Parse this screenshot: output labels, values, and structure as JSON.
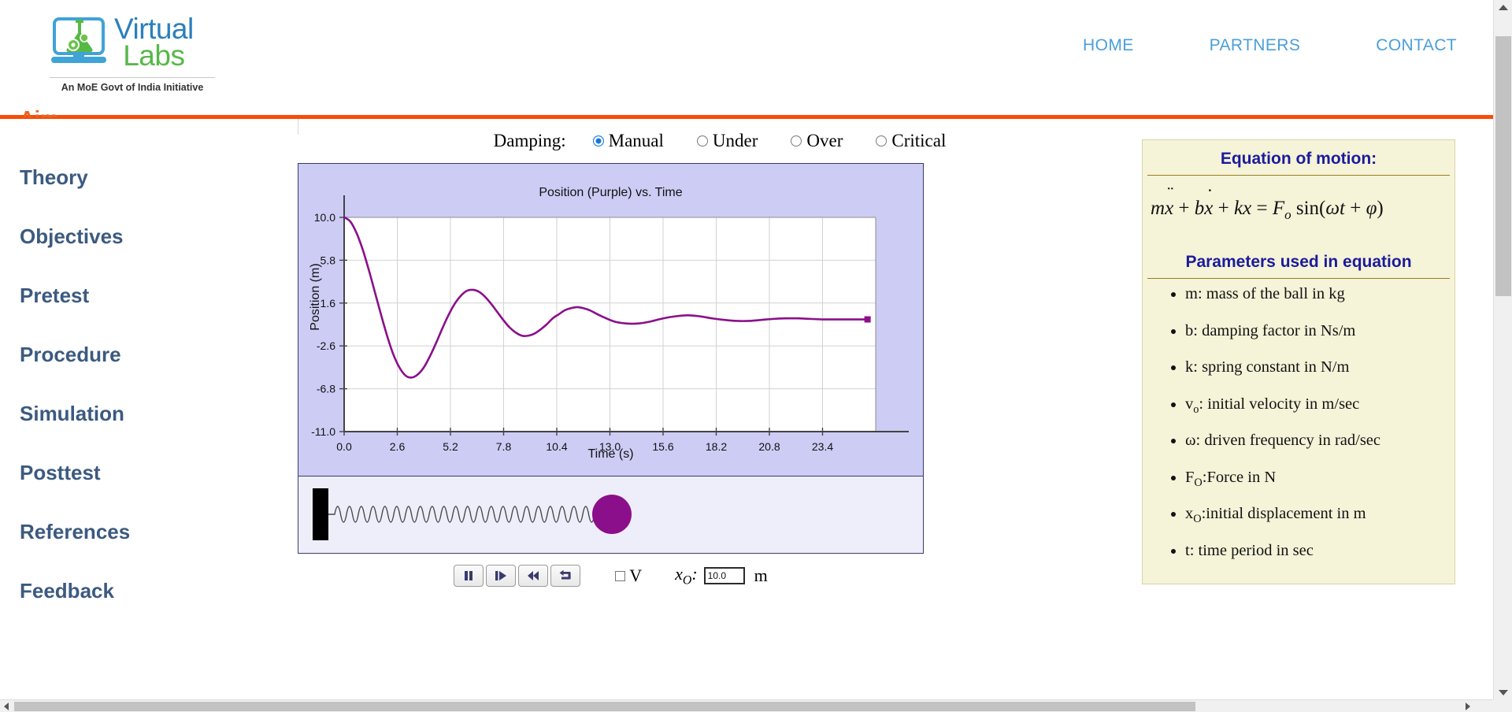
{
  "header": {
    "logo_primary": "Virtual",
    "logo_secondary": "Labs",
    "logo_tagline": "An MoE Govt of India Initiative",
    "nav": [
      {
        "label": "HOME"
      },
      {
        "label": "PARTNERS"
      },
      {
        "label": "CONTACT"
      }
    ],
    "accent_color": "#fa4b09",
    "nav_link_color": "#4a9fd8"
  },
  "sidebar": {
    "items": [
      {
        "label": "Aim",
        "active": true
      },
      {
        "label": "Theory",
        "active": false
      },
      {
        "label": "Objectives",
        "active": false
      },
      {
        "label": "Pretest",
        "active": false
      },
      {
        "label": "Procedure",
        "active": false
      },
      {
        "label": "Simulation",
        "active": false
      },
      {
        "label": "Posttest",
        "active": false
      },
      {
        "label": "References",
        "active": false
      },
      {
        "label": "Feedback",
        "active": false
      }
    ],
    "active_color": "#e8641e",
    "item_color": "#3c5a80"
  },
  "damping": {
    "label": "Damping:",
    "options": [
      {
        "label": "Manual",
        "selected": true
      },
      {
        "label": "Under",
        "selected": false
      },
      {
        "label": "Over",
        "selected": false
      },
      {
        "label": "Critical",
        "selected": false
      }
    ],
    "selected_color": "#1677e0"
  },
  "chart_data": {
    "type": "line",
    "title": "Position (Purple) vs. Time",
    "xlabel": "Time (s)",
    "ylabel": "Position (m)",
    "xlim": [
      0.0,
      26.0
    ],
    "ylim": [
      -11.0,
      10.0
    ],
    "xticks": [
      "0.0",
      "2.6",
      "5.2",
      "7.8",
      "10.4",
      "13.0",
      "15.6",
      "18.2",
      "20.8",
      "23.4"
    ],
    "yticks": [
      "10.0",
      "5.8",
      "1.6",
      "-2.6",
      "-6.8",
      "-11.0"
    ],
    "grid": true,
    "legend": "none",
    "series": [
      {
        "name": "Position",
        "color": "#8b0f8b",
        "x": [
          0.0,
          0.3,
          0.6,
          0.9,
          1.2,
          1.5,
          1.8,
          2.1,
          2.4,
          2.7,
          3.0,
          3.3,
          3.6,
          3.9,
          4.2,
          4.5,
          4.8,
          5.1,
          5.4,
          5.7,
          6.0,
          6.3,
          6.6,
          6.9,
          7.2,
          7.5,
          7.8,
          8.1,
          8.4,
          8.7,
          9.0,
          9.3,
          9.6,
          9.9,
          10.2,
          10.5,
          10.8,
          11.1,
          11.4,
          11.7,
          12.0,
          12.6,
          13.2,
          13.8,
          14.4,
          15.0,
          15.6,
          16.2,
          16.8,
          17.4,
          18.0,
          18.6,
          19.2,
          19.8,
          20.4,
          21.0,
          21.6,
          22.2,
          22.8,
          23.4,
          24.0,
          24.6,
          25.2,
          25.6
        ],
        "y": [
          10.0,
          9.6,
          8.5,
          6.9,
          4.9,
          2.7,
          0.5,
          -1.6,
          -3.4,
          -4.7,
          -5.5,
          -5.7,
          -5.4,
          -4.7,
          -3.6,
          -2.3,
          -0.9,
          0.4,
          1.5,
          2.3,
          2.8,
          2.9,
          2.7,
          2.2,
          1.5,
          0.7,
          -0.1,
          -0.8,
          -1.3,
          -1.6,
          -1.6,
          -1.4,
          -1.0,
          -0.5,
          0.1,
          0.5,
          0.9,
          1.1,
          1.2,
          1.1,
          0.9,
          0.3,
          -0.2,
          -0.4,
          -0.4,
          -0.2,
          0.1,
          0.3,
          0.4,
          0.3,
          0.1,
          -0.05,
          -0.15,
          -0.15,
          -0.05,
          0.05,
          0.1,
          0.1,
          0.05,
          0.0,
          0.0,
          0.0,
          0.0,
          0.0
        ],
        "marker_end": true
      }
    ],
    "plot_bg": "#ffffff",
    "panel_bg": "#ccccf5"
  },
  "animation": {
    "wall_color": "#000000",
    "spring_color": "#4a4a4a",
    "ball_color": "#8b0f8b",
    "panel_bg": "#eeeefb",
    "spring_coils": 22
  },
  "transport": {
    "buttons": [
      {
        "name": "pause",
        "label": "Pause"
      },
      {
        "name": "step-forward",
        "label": "Step forward"
      },
      {
        "name": "rewind",
        "label": "Rewind"
      },
      {
        "name": "reset",
        "label": "Reset"
      }
    ],
    "velocity_checkbox_label": "V",
    "velocity_checked": false,
    "x0_label": "x",
    "x0_subscript": "O",
    "x0_colon": ":",
    "x0_value": "10.0",
    "x0_unit": "m"
  },
  "info_panel": {
    "equation_heading": "Equation of motion:",
    "equation_parts": {
      "m": "m",
      "x_ddot": "x",
      "plus1": " + ",
      "b": "b",
      "x_dot": "x",
      "plus2": " + ",
      "k": "k",
      "x": "x",
      "equals": " = ",
      "F": "F",
      "F_sub": "o",
      "sin": "sin(",
      "omega": "ω",
      "t": "t",
      "plus3": " + ",
      "phi": "φ",
      "close": ")"
    },
    "equation_plain": "mẍ̈ + bẋ + kx = Fₒ sin(ωt + φ)",
    "params_heading": "Parameters used in equation",
    "params": [
      {
        "symbol": "m",
        "sub": "",
        "text": ": mass of the ball in kg"
      },
      {
        "symbol": "b",
        "sub": "",
        "text": ": damping factor in Ns/m"
      },
      {
        "symbol": "k",
        "sub": "",
        "text": ": spring constant in N/m"
      },
      {
        "symbol": "v",
        "sub": "o",
        "text": ": initial velocity in m/sec"
      },
      {
        "symbol": "ω",
        "sub": "",
        "text": ": driven frequency in rad/sec"
      },
      {
        "symbol": "F",
        "sub": "O",
        "text": ":Force in N"
      },
      {
        "symbol": "x",
        "sub": "O",
        "text": ":initial displacement in m"
      },
      {
        "symbol": "t",
        "sub": "",
        "text": ": time period in sec"
      }
    ],
    "heading_color": "#1b1b9c",
    "bg_color": "#f5f3d8"
  },
  "scrollbars": {
    "vertical_visible": true,
    "horizontal_visible": true
  }
}
